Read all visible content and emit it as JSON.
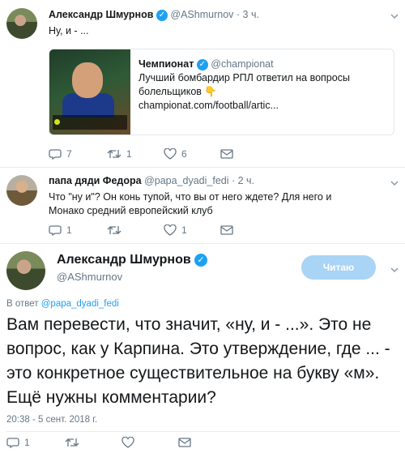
{
  "tweet1": {
    "author": "Александр Шмурнов",
    "handle": "@AShmurnov",
    "time": "· 3 ч.",
    "text": "Ну, и - ...",
    "card": {
      "source_name": "Чемпионат",
      "source_handle": "@championat",
      "headline": "Лучший бомбардир РПЛ ответил на вопросы болельщиков 👇",
      "link": "championat.com/football/artic..."
    },
    "actions": {
      "replies": "7",
      "retweets": "1",
      "likes": "6"
    }
  },
  "tweet2": {
    "author": "папа дяди Федора",
    "handle": "@papa_dyadi_fedi",
    "time": "· 2 ч.",
    "text": "Что \"ну и\"? Он конь тупой, что вы от него ждете? Для него и Монако средний европейский клуб",
    "actions": {
      "replies": "1",
      "retweets": "",
      "likes": "1"
    }
  },
  "main_tweet": {
    "author": "Александр Шмурнов",
    "handle": "@AShmurnov",
    "follow_button": "Читаю",
    "reply_to_prefix": "В ответ",
    "reply_to_handle": "@papa_dyadi_fedi",
    "text": "Вам перевести, что значит, «ну, и - ...». Это не вопрос, как у Карпина. Это утверждение, где ... - это конкретное существительное на букву «м». Ещё нужны комментарии?",
    "timestamp": "20:38 - 5 сент. 2018 г.",
    "actions": {
      "replies": "1",
      "retweets": "",
      "likes": ""
    }
  },
  "colors": {
    "accent": "#1da1f2",
    "muted": "#657786",
    "button": "#a9d4f5"
  }
}
